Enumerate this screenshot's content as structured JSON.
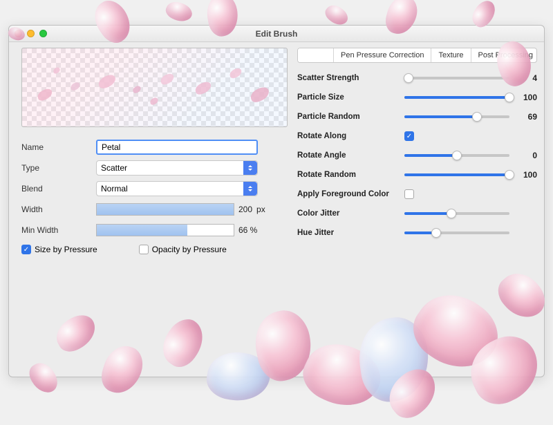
{
  "window": {
    "title": "Edit Brush"
  },
  "left": {
    "name_label": "Name",
    "name_value": "Petal",
    "type_label": "Type",
    "type_value": "Scatter",
    "blend_label": "Blend",
    "blend_value": "Normal",
    "width_label": "Width",
    "width_value": "200",
    "width_unit": "px",
    "minwidth_label": "Min Width",
    "minwidth_value": "66 %",
    "minwidth_pct": 66,
    "size_by_pressure": "Size by Pressure",
    "size_by_pressure_on": true,
    "opacity_by_pressure": "Opacity by Pressure",
    "opacity_by_pressure_on": false
  },
  "tabs": {
    "active_blank": "",
    "pen": "Pen Pressure Correction",
    "texture": "Texture",
    "post": "Post Processing"
  },
  "sliders": {
    "scatter_strength": {
      "label": "Scatter Strength",
      "value": 4,
      "pct": 4
    },
    "particle_size": {
      "label": "Particle Size",
      "value": 100,
      "pct": 100
    },
    "particle_random": {
      "label": "Particle Random",
      "value": 69,
      "pct": 69
    },
    "rotate_along": {
      "label": "Rotate Along",
      "on": true
    },
    "rotate_angle": {
      "label": "Rotate Angle",
      "value": 0,
      "pct": 50
    },
    "rotate_random": {
      "label": "Rotate Random",
      "value": 100,
      "pct": 100
    },
    "apply_fg": {
      "label": "Apply Foreground Color",
      "on": false
    },
    "color_jitter": {
      "label": "Color Jitter",
      "value": "",
      "pct": 45
    },
    "hue_jitter": {
      "label": "Hue Jitter",
      "value": "",
      "pct": 30
    }
  }
}
